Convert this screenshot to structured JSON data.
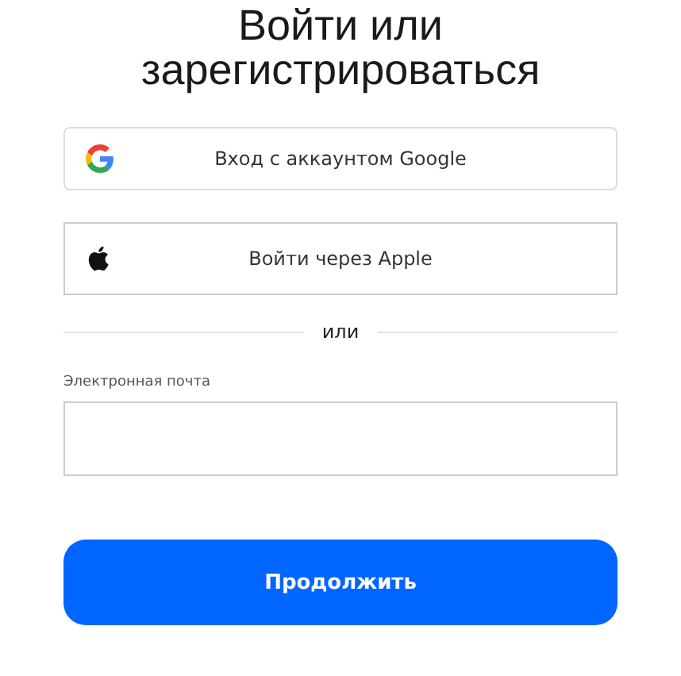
{
  "title": "Войти или зарегистрироваться",
  "providers": [
    {
      "kind": "google",
      "label": "Вход с аккаунтом Google"
    },
    {
      "kind": "apple",
      "label": "Войти через Apple"
    }
  ],
  "separator": "или",
  "email": {
    "label": "Электронная почта"
  },
  "submit": "Продолжить"
}
